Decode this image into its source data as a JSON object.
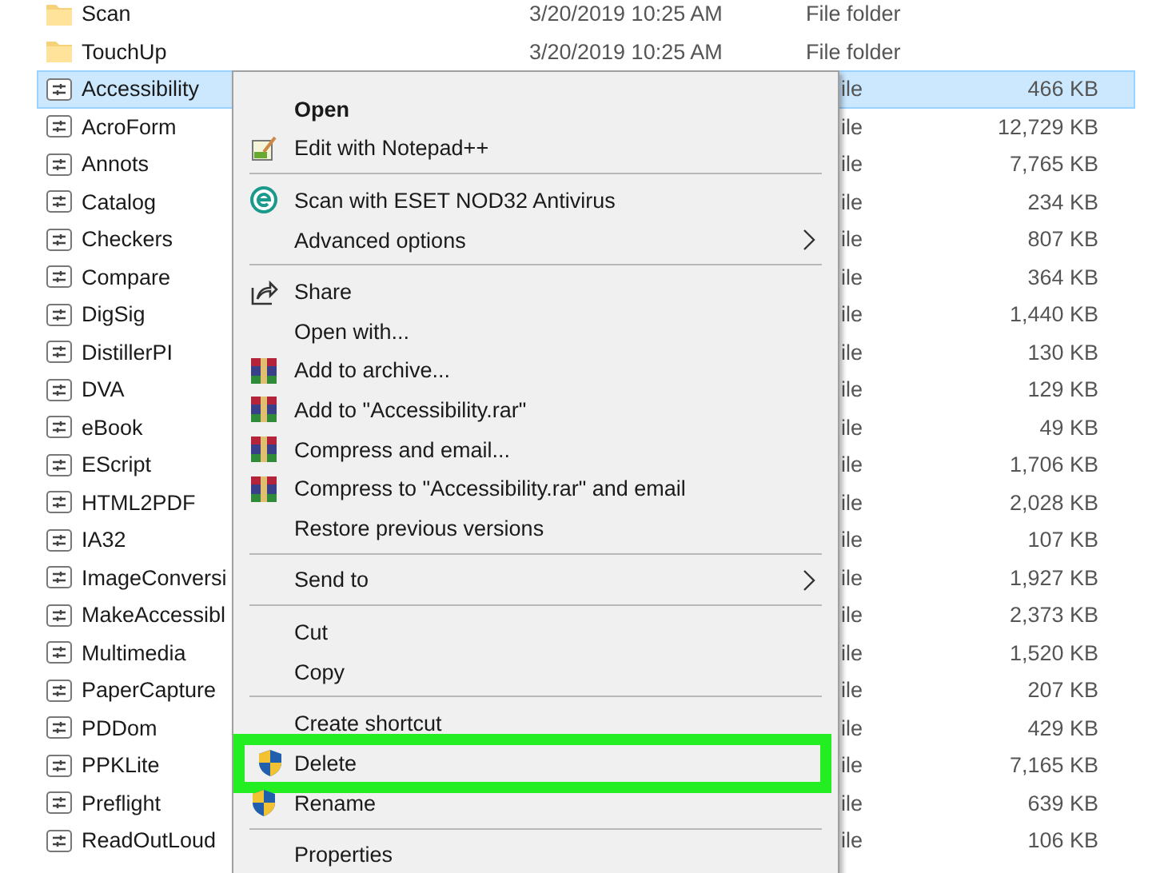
{
  "files": [
    {
      "kind": "folder",
      "name": "Scan",
      "date": "3/20/2019 10:25 AM",
      "type": "File folder",
      "selected": false
    },
    {
      "kind": "folder",
      "name": "TouchUp",
      "date": "3/20/2019 10:25 AM",
      "type": "File folder",
      "selected": false
    },
    {
      "kind": "file",
      "name": "Accessibility",
      "type": "ile",
      "size": "466 KB",
      "selected": true
    },
    {
      "kind": "file",
      "name": "AcroForm",
      "type": "ile",
      "size": "12,729 KB",
      "selected": false
    },
    {
      "kind": "file",
      "name": "Annots",
      "type": "ile",
      "size": "7,765 KB",
      "selected": false
    },
    {
      "kind": "file",
      "name": "Catalog",
      "type": "ile",
      "size": "234 KB",
      "selected": false
    },
    {
      "kind": "file",
      "name": "Checkers",
      "type": "ile",
      "size": "807 KB",
      "selected": false
    },
    {
      "kind": "file",
      "name": "Compare",
      "type": "ile",
      "size": "364 KB",
      "selected": false
    },
    {
      "kind": "file",
      "name": "DigSig",
      "type": "ile",
      "size": "1,440 KB",
      "selected": false
    },
    {
      "kind": "file",
      "name": "DistillerPI",
      "type": "ile",
      "size": "130 KB",
      "selected": false
    },
    {
      "kind": "file",
      "name": "DVA",
      "type": "ile",
      "size": "129 KB",
      "selected": false
    },
    {
      "kind": "file",
      "name": "eBook",
      "type": "ile",
      "size": "49 KB",
      "selected": false
    },
    {
      "kind": "file",
      "name": "EScript",
      "type": "ile",
      "size": "1,706 KB",
      "selected": false
    },
    {
      "kind": "file",
      "name": "HTML2PDF",
      "type": "ile",
      "size": "2,028 KB",
      "selected": false
    },
    {
      "kind": "file",
      "name": "IA32",
      "type": "ile",
      "size": "107 KB",
      "selected": false
    },
    {
      "kind": "file",
      "name": "ImageConversi",
      "type": "ile",
      "size": "1,927 KB",
      "selected": false
    },
    {
      "kind": "file",
      "name": "MakeAccessibl",
      "type": "ile",
      "size": "2,373 KB",
      "selected": false
    },
    {
      "kind": "file",
      "name": "Multimedia",
      "type": "ile",
      "size": "1,520 KB",
      "selected": false
    },
    {
      "kind": "file",
      "name": "PaperCapture",
      "type": "ile",
      "size": "207 KB",
      "selected": false
    },
    {
      "kind": "file",
      "name": "PDDom",
      "type": "ile",
      "size": "429 KB",
      "selected": false
    },
    {
      "kind": "file",
      "name": "PPKLite",
      "type": "ile",
      "size": "7,165 KB",
      "selected": false
    },
    {
      "kind": "file",
      "name": "Preflight",
      "type": "ile",
      "size": "639 KB",
      "selected": false
    },
    {
      "kind": "file",
      "name": "ReadOutLoud",
      "type": "ile",
      "size": "106 KB",
      "selected": false
    }
  ],
  "context_menu": [
    {
      "kind": "item",
      "label": "Open",
      "default": true
    },
    {
      "kind": "notepad",
      "label": "Edit with Notepad++"
    },
    {
      "kind": "separator"
    },
    {
      "kind": "eset",
      "label": "Scan with ESET NOD32 Antivirus"
    },
    {
      "kind": "item",
      "label": "Advanced options",
      "submenu": true
    },
    {
      "kind": "separator"
    },
    {
      "kind": "share",
      "label": "Share"
    },
    {
      "kind": "item",
      "label": "Open with..."
    },
    {
      "kind": "archive",
      "label": "Add to archive..."
    },
    {
      "kind": "archive",
      "label": "Add to \"Accessibility.rar\""
    },
    {
      "kind": "archive",
      "label": "Compress and email..."
    },
    {
      "kind": "archive",
      "label": "Compress to \"Accessibility.rar\" and email"
    },
    {
      "kind": "item",
      "label": "Restore previous versions"
    },
    {
      "kind": "separator"
    },
    {
      "kind": "item",
      "label": "Send to",
      "submenu": true
    },
    {
      "kind": "separator"
    },
    {
      "kind": "item",
      "label": "Cut"
    },
    {
      "kind": "item",
      "label": "Copy"
    },
    {
      "kind": "separator"
    },
    {
      "kind": "item",
      "label": "Create shortcut"
    },
    {
      "kind": "shield",
      "label": "Delete",
      "highlighted": true
    },
    {
      "kind": "shield",
      "label": "Rename"
    },
    {
      "kind": "separator"
    },
    {
      "kind": "item",
      "label": "Properties"
    }
  ]
}
